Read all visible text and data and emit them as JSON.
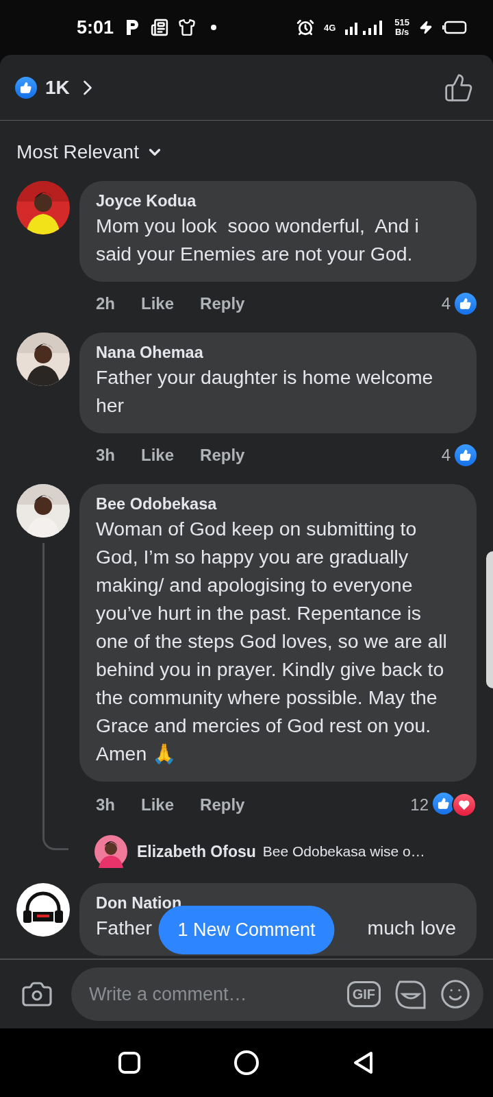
{
  "status_bar": {
    "time": "5:01",
    "network": "4G",
    "speed": "515",
    "speed_unit": "B/s"
  },
  "reactions_header": {
    "count": "1K"
  },
  "sort": {
    "label": "Most Relevant"
  },
  "comments": [
    {
      "author": "Joyce Kodua",
      "avatar": {
        "kind": "picture"
      },
      "text": "Mom you look  sooo wonderful,  And i said your Enemies are not your God.",
      "time": "2h",
      "like": "Like",
      "reply": "Reply",
      "reaction_count": "4",
      "reactions": [
        {
          "kind": "like"
        }
      ]
    },
    {
      "author": "Nana Ohemaa",
      "avatar": {
        "kind": "picture"
      },
      "text": "Father your daughter is home welcome her",
      "time": "3h",
      "like": "Like",
      "reply": "Reply",
      "reaction_count": "4",
      "reactions": [
        {
          "kind": "like"
        }
      ]
    },
    {
      "author": "Bee Odobekasa",
      "avatar": {
        "kind": "picture"
      },
      "text": "Woman of God keep on submitting to God, I’m so happy you are gradually making/ and apologising to everyone you’ve hurt in the past. Repentance is one of the steps God loves, so we are all behind you in prayer. Kindly give back to the community where possible. May the Grace and mercies of God rest on you. Amen 🙏",
      "time": "3h",
      "like": "Like",
      "reply": "Reply",
      "reaction_count": "12",
      "reactions": [
        {
          "kind": "like"
        },
        {
          "kind": "love"
        }
      ],
      "replies": [
        {
          "author": "Elizabeth Ofosu",
          "text": "Bee Odobekasa wise o…"
        }
      ]
    },
    {
      "author": "Don Nation",
      "avatar": {
        "kind": "logo"
      },
      "text_visible": [
        "Father",
        "much love"
      ]
    }
  ],
  "new_comments_button": "1 New Comment",
  "composer": {
    "placeholder": "Write a comment…",
    "gif_label": "GIF"
  }
}
